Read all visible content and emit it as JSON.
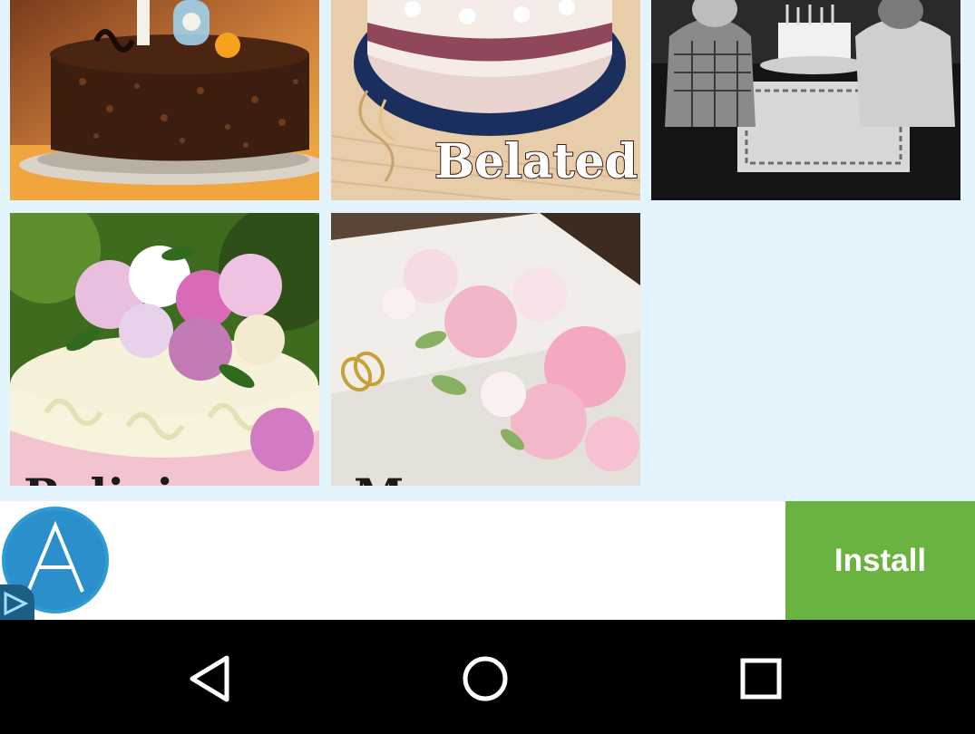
{
  "grid": {
    "tiles": [
      {
        "id": "cake-18",
        "caption": ""
      },
      {
        "id": "belated",
        "caption": "Belated"
      },
      {
        "id": "kittens",
        "caption": ""
      },
      {
        "id": "religious",
        "caption": "Religio"
      },
      {
        "id": "marriage",
        "caption": "M"
      }
    ]
  },
  "ad": {
    "logo_letter": "A",
    "install_label": "Install",
    "install_color": "#6ab341",
    "adchoices_icon": "adchoices-icon"
  },
  "nav": {
    "back_icon": "back-icon",
    "home_icon": "home-icon",
    "recents_icon": "recents-icon"
  }
}
